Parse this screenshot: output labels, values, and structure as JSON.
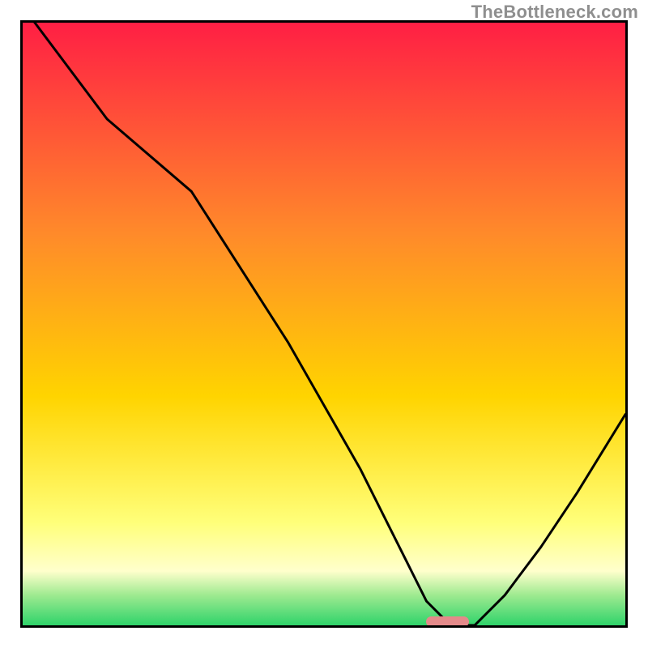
{
  "watermark": "TheBottleneck.com",
  "colors": {
    "red": "#ff1f44",
    "orange": "#ff8a2a",
    "yellow_mid": "#ffd400",
    "yellow_pale": "#ffff7a",
    "yellow_vpale": "#ffffcc",
    "green_light": "#9eea90",
    "green": "#2fd36a",
    "marker": "#e48a8a",
    "curve": "#000000",
    "frame": "#000000",
    "bg": "#ffffff"
  },
  "chart_data": {
    "type": "line",
    "title": "",
    "xlabel": "",
    "ylabel": "",
    "xlim": [
      0,
      100
    ],
    "ylim": [
      0,
      100
    ],
    "x": [
      0,
      14,
      28,
      44,
      56,
      64,
      67,
      71,
      73,
      75,
      80,
      86,
      92,
      100
    ],
    "values": [
      104,
      84,
      72,
      47,
      26,
      10,
      4,
      0,
      0,
      0,
      5,
      13,
      22,
      35
    ],
    "marker": {
      "x_start": 67,
      "x_end": 74,
      "y": 0
    },
    "gradient_stops": [
      {
        "pct": 0,
        "color_key": "red"
      },
      {
        "pct": 35,
        "color_key": "orange"
      },
      {
        "pct": 62,
        "color_key": "yellow_mid"
      },
      {
        "pct": 83,
        "color_key": "yellow_pale"
      },
      {
        "pct": 91,
        "color_key": "yellow_vpale"
      },
      {
        "pct": 95,
        "color_key": "green_light"
      },
      {
        "pct": 100,
        "color_key": "green"
      }
    ],
    "note": "Axes are unlabeled in the source image; values are estimated on a 0–100 scale. The curve descends from top-left, flattens near x≈67–74 at y≈0 (pink marker), then rises toward the right edge reaching ~35 at x=100."
  }
}
